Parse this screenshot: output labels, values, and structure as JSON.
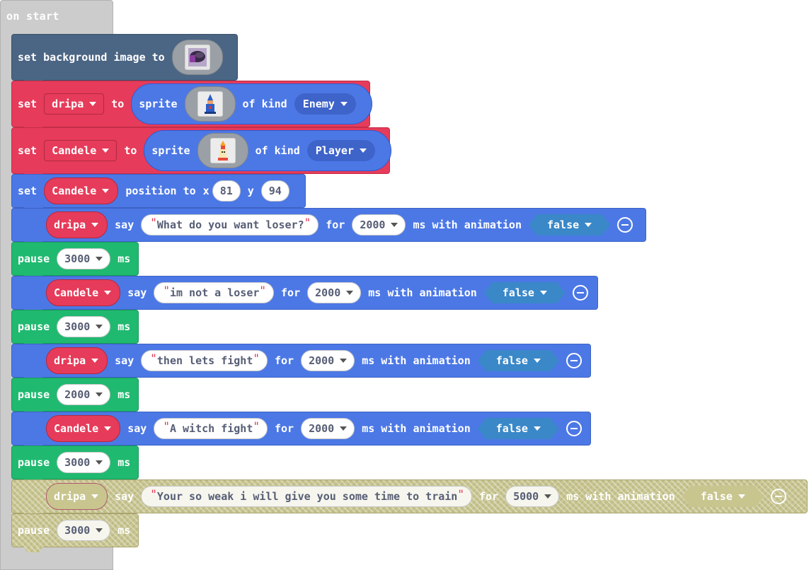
{
  "on_start": "on start",
  "bg_block": {
    "label": "set background image to",
    "image_icon": "background-image-thumbnail-icon"
  },
  "sprite_blocks": [
    {
      "set": "set",
      "var": "dripa",
      "to": "to",
      "sprite": "sprite",
      "of_kind": "of kind",
      "kind": "Enemy",
      "image_icon": "wizard-sprite-thumbnail-icon"
    },
    {
      "set": "set",
      "var": "Candele",
      "to": "to",
      "sprite": "sprite",
      "of_kind": "of kind",
      "kind": "Player",
      "image_icon": "candle-sprite-thumbnail-icon"
    }
  ],
  "position_block": {
    "set": "set",
    "var": "Candele",
    "label": "position to",
    "x_label": "x",
    "x": "81",
    "y_label": "y",
    "y": "94"
  },
  "say_blocks": [
    {
      "sprite": "dripa",
      "say": "say",
      "text": "What do you want loser?",
      "for": "for",
      "ms": "2000",
      "ms_label": "ms with animation",
      "anim": "false"
    },
    {
      "sprite": "Candele",
      "say": "say",
      "text": "im not a loser",
      "for": "for",
      "ms": "2000",
      "ms_label": "ms with animation",
      "anim": "false"
    },
    {
      "sprite": "dripa",
      "say": "say",
      "text": "then lets fight",
      "for": "for",
      "ms": "2000",
      "ms_label": "ms with animation",
      "anim": "false"
    },
    {
      "sprite": "Candele",
      "say": "say",
      "text": "A witch fight",
      "for": "for",
      "ms": "2000",
      "ms_label": "ms with animation",
      "anim": "false"
    },
    {
      "sprite": "dripa",
      "say": "say",
      "text": "Your so weak i will give you some time to train",
      "for": "for",
      "ms": "5000",
      "ms_label": "ms with animation",
      "anim": "false"
    }
  ],
  "pause_blocks": [
    {
      "pause": "pause",
      "ms": "3000",
      "unit": "ms"
    },
    {
      "pause": "pause",
      "ms": "3000",
      "unit": "ms"
    },
    {
      "pause": "pause",
      "ms": "2000",
      "unit": "ms"
    },
    {
      "pause": "pause",
      "ms": "3000",
      "unit": "ms"
    },
    {
      "pause": "pause",
      "ms": "3000",
      "unit": "ms"
    }
  ],
  "quote": "\""
}
